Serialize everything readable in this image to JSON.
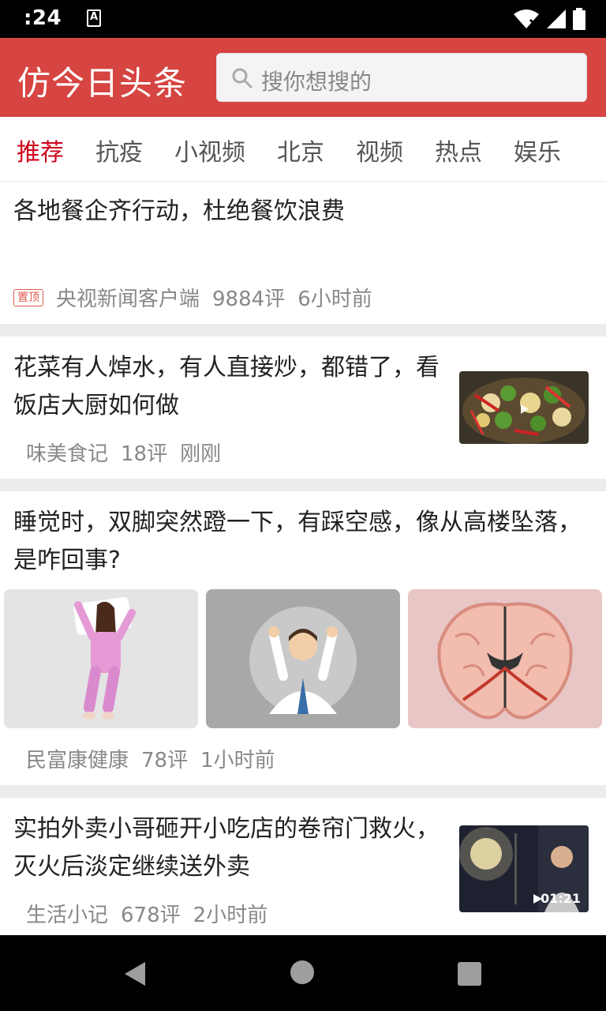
{
  "status_bar": {
    "time": ":24",
    "a_icon": "A"
  },
  "app_bar": {
    "title": "仿今日头条",
    "search_placeholder": "搜你想搜的"
  },
  "tabs": [
    {
      "label": "推荐",
      "active": true
    },
    {
      "label": "抗疫"
    },
    {
      "label": "小视频"
    },
    {
      "label": "北京"
    },
    {
      "label": "视频"
    },
    {
      "label": "热点"
    },
    {
      "label": "娱乐"
    }
  ],
  "feed": [
    {
      "title": "各地餐企齐行动，杜绝餐饮浪费",
      "badge": "置顶",
      "source": "央视新闻客户端",
      "comments": "9884评",
      "time": "6小时前"
    },
    {
      "title": "花菜有人焯水，有人直接炒，都错了，看饭店大厨如何做",
      "source": "味美食记",
      "comments": "18评",
      "time": "刚刚"
    },
    {
      "title": "睡觉时，双脚突然蹬一下，有踩空感，像从高楼坠落，是咋回事?",
      "source": "民富康健康",
      "comments": "78评",
      "time": "1小时前"
    },
    {
      "title": "实拍外卖小哥砸开小吃店的卷帘门救火，灭火后淡定继续送外卖",
      "source": "生活小记",
      "comments": "678评",
      "time": "2小时前",
      "video_duration": "01:21"
    }
  ],
  "colors": {
    "brand_red": "#d64541",
    "active_tab": "#d0021b",
    "meta_gray": "#888888"
  }
}
